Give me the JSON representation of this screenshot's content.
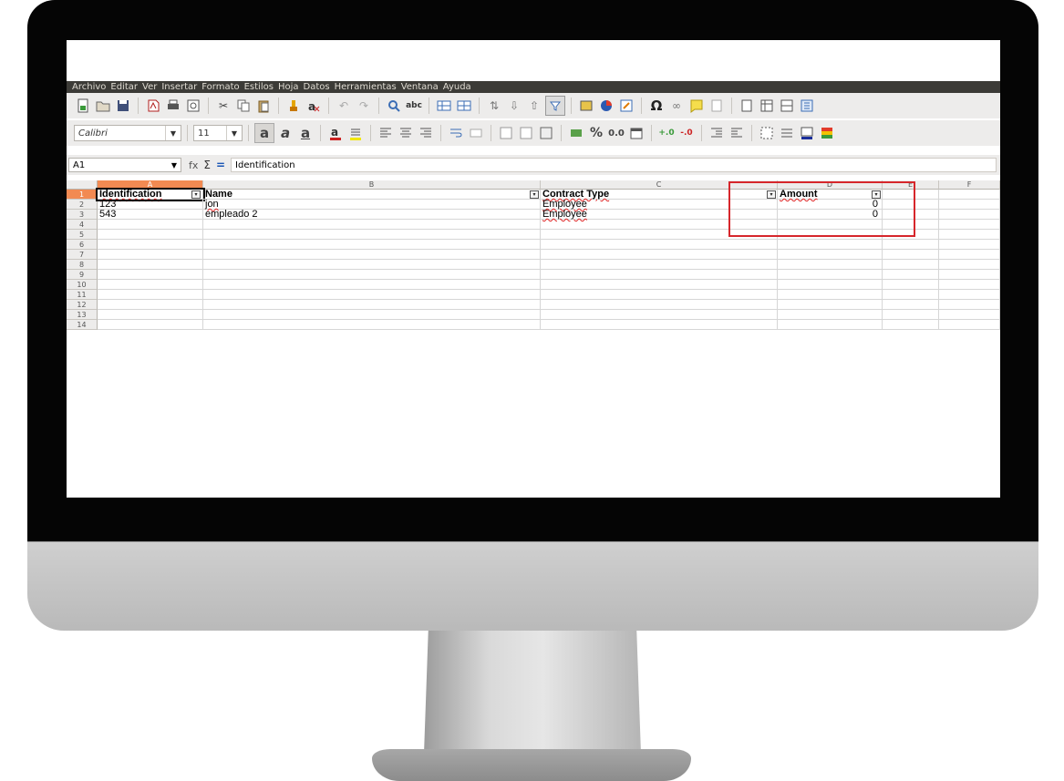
{
  "menubar": {
    "items": [
      "Archivo",
      "Editar",
      "Ver",
      "Insertar",
      "Formato",
      "Estilos",
      "Hoja",
      "Datos",
      "Herramientas",
      "Ventana",
      "Ayuda"
    ]
  },
  "formatting": {
    "font_name": "Calibri",
    "font_size": "11"
  },
  "formula_bar": {
    "cell_ref": "A1",
    "content": "Identification",
    "fx": "fx",
    "sigma": "Σ",
    "equals": "="
  },
  "sheet": {
    "columns": [
      "A",
      "B",
      "C",
      "D",
      "E",
      "F"
    ],
    "rows": [
      "1",
      "2",
      "3",
      "4",
      "5",
      "6",
      "7",
      "8",
      "9",
      "10",
      "11",
      "12",
      "13",
      "14"
    ],
    "headers": {
      "a": "Identification",
      "b": "Name",
      "c": "Contract Type",
      "d": "Amount"
    },
    "data": [
      {
        "a": "123",
        "b": "jon",
        "c": "Employee",
        "d": "0"
      },
      {
        "a": "543",
        "b": "empleado 2",
        "c": "Employee",
        "d": "0"
      }
    ],
    "filter_glyph": "▾"
  },
  "annotation": {
    "color": "#d6262b"
  }
}
